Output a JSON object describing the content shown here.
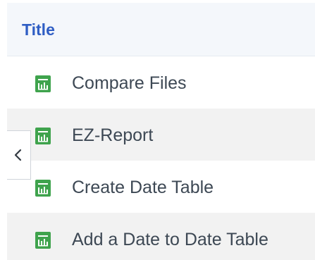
{
  "header": {
    "title": "Title"
  },
  "rows": [
    {
      "label": "Compare Files",
      "icon": "spreadsheet-file-icon"
    },
    {
      "label": "EZ-Report",
      "icon": "spreadsheet-file-icon"
    },
    {
      "label": "Create Date Table",
      "icon": "spreadsheet-file-icon"
    },
    {
      "label": "Add a Date to Date Table",
      "icon": "spreadsheet-file-icon"
    }
  ],
  "collapse": {
    "icon": "chevron-left-icon"
  },
  "colors": {
    "title": "#2f5ec4",
    "icon_green": "#3fa34d",
    "text": "#3d4854"
  }
}
